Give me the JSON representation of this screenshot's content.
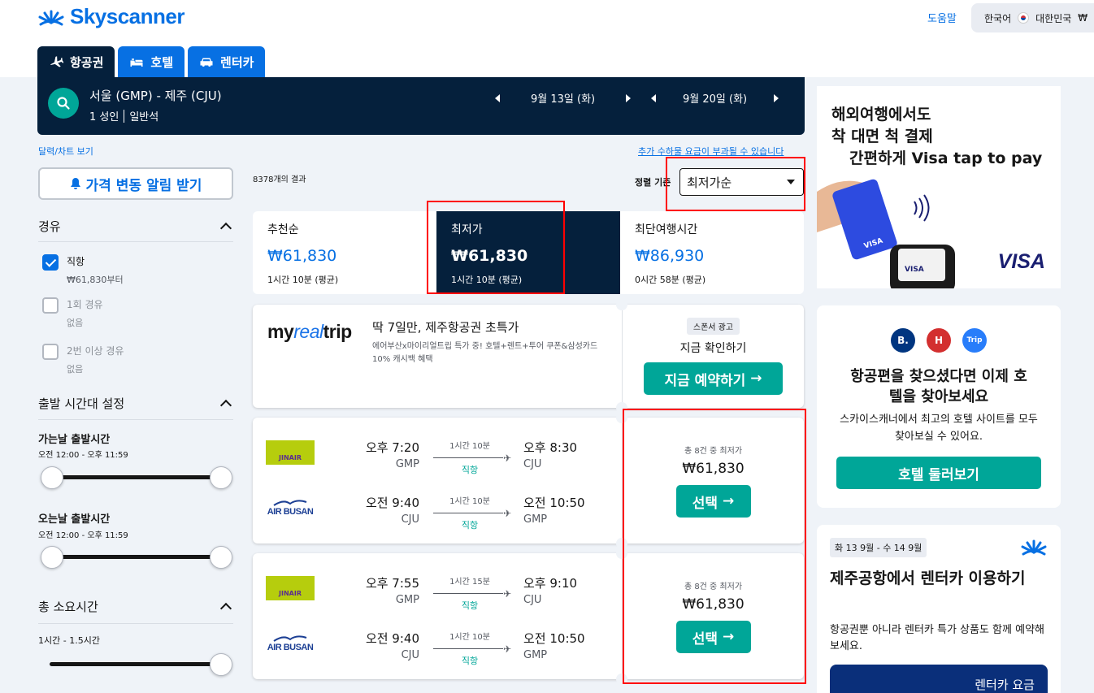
{
  "header": {
    "brand": "Skyscanner",
    "help": "도움말",
    "language": "한국어",
    "country": "대한민국",
    "currency": "₩"
  },
  "tabs": [
    {
      "label": "항공권",
      "icon": "plane-icon"
    },
    {
      "label": "호텔",
      "icon": "bed-icon"
    },
    {
      "label": "렌터카",
      "icon": "car-icon"
    }
  ],
  "search": {
    "route": "서울 (GMP) - 제주 (CJU)",
    "passengers": "1 성인",
    "cabin": "일반석",
    "depart_date": "9월 13일 (화)",
    "return_date": "9월 20일 (화)"
  },
  "filters": {
    "calendar_link": "달력/차트 보기",
    "price_alert": "가격 변동 알림 받기",
    "stops_title": "경유",
    "stops": [
      {
        "label": "직항",
        "sub": "₩61,830부터",
        "checked": true
      },
      {
        "label": "1회 경유",
        "sub": "없음",
        "checked": false
      },
      {
        "label": "2번 이상 경유",
        "sub": "없음",
        "checked": false
      }
    ],
    "time_title": "출발 시간대 설정",
    "outbound_label": "가는날 출발시간",
    "outbound_range": "오전 12:00 - 오후 11:59",
    "return_label": "오는날 출발시간",
    "return_range": "오전 12:00 - 오후 11:59",
    "duration_title": "총 소요시간",
    "duration_range": "1시간 - 1.5시간"
  },
  "results": {
    "count": "8378개의 결과",
    "extra_fees": "추가 수하물 요금이 부과될 수 있습니다",
    "sort_label": "정렬 기준",
    "sort_value": "최저가순",
    "sort_tabs": [
      {
        "title": "추천순",
        "price": "₩61,830",
        "sub": "1시간 10분 (평균)"
      },
      {
        "title": "최저가",
        "price": "₩61,830",
        "sub": "1시간 10분 (평균)"
      },
      {
        "title": "최단여행시간",
        "price": "₩86,930",
        "sub": "0시간 58분 (평균)"
      }
    ]
  },
  "ad": {
    "logo_a": "my",
    "logo_b": "real",
    "logo_c": "trip",
    "title": "딱 7일만, 제주항공권 초특가",
    "desc": "에어부산x마이리얼트립 특가 중! 호텔+렌트+투어 쿠폰&삼성카드 10% 캐시백 혜택",
    "badge": "스폰서 광고",
    "sub": "지금 확인하기",
    "cta": "지금 예약하기"
  },
  "flights": [
    {
      "legs": [
        {
          "airline": "JINAIR",
          "dep_time": "오후 7:20",
          "dep_code": "GMP",
          "duration": "1시간 10분",
          "stops": "직항",
          "arr_time": "오후 8:30",
          "arr_code": "CJU"
        },
        {
          "airline": "AIR BUSAN",
          "dep_time": "오전 9:40",
          "dep_code": "CJU",
          "duration": "1시간 10분",
          "stops": "직항",
          "arr_time": "오전 10:50",
          "arr_code": "GMP"
        }
      ],
      "price_meta": "총 8건 중 최저가",
      "price": "₩61,830",
      "select": "선택"
    },
    {
      "legs": [
        {
          "airline": "JINAIR",
          "dep_time": "오후 7:55",
          "dep_code": "GMP",
          "duration": "1시간 15분",
          "stops": "직항",
          "arr_time": "오후 9:10",
          "arr_code": "CJU"
        },
        {
          "airline": "AIR BUSAN",
          "dep_time": "오전 9:40",
          "dep_code": "CJU",
          "duration": "1시간 10분",
          "stops": "직항",
          "arr_time": "오전 10:50",
          "arr_code": "GMP"
        }
      ],
      "price_meta": "총 8건 중 최저가",
      "price": "₩61,830",
      "select": "선택"
    }
  ],
  "visa_ad": {
    "line1": "해외여행에서도",
    "line2": "착 대면 척 결제",
    "line3": "간편하게 Visa tap to pay",
    "logo": "VISA"
  },
  "hotel_promo": {
    "brands": [
      {
        "label": "B.",
        "color": "#003580"
      },
      {
        "label": "H",
        "color": "#d32f2f"
      },
      {
        "label": "Trip",
        "color": "#287dfa"
      }
    ],
    "title": "항공편을 찾으셨다면 이제 호텔을 찾아보세요",
    "desc": "스카이스캐너에서 최고의 호텔 사이트를 모두 찾아보실 수 있어요.",
    "cta": "호텔 둘러보기"
  },
  "car_promo": {
    "date": "화 13 9월 - 수 14 9월",
    "title": "제주공항에서 렌터카 이용하기",
    "desc": "항공권뿐 아니라 렌터카 특가 상품도 함께 예약해보세요.",
    "banner": "렌터카 요금"
  },
  "colors": {
    "brand_blue": "#0770e3",
    "navy": "#05203c",
    "teal": "#00a698",
    "highlight": "#ff0000"
  }
}
